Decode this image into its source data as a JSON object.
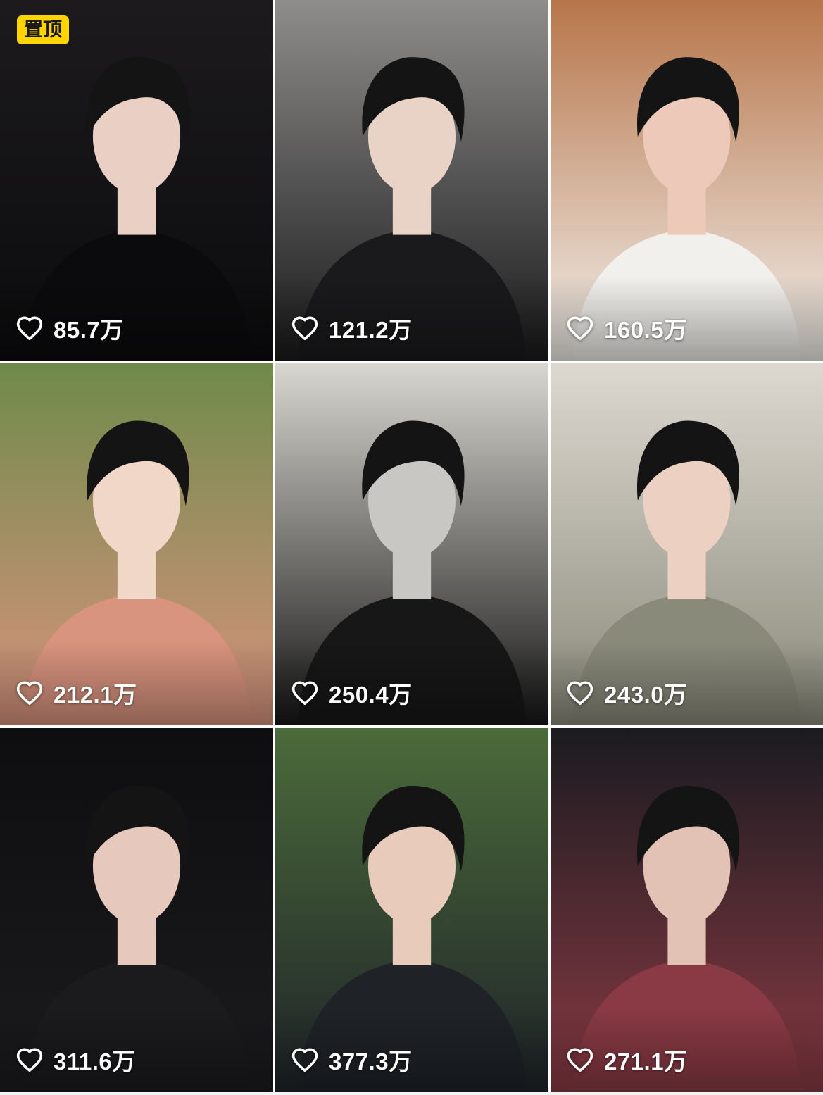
{
  "pinned_label": "置顶",
  "videos": [
    {
      "likes": "85.7万",
      "pinned": true,
      "thumb_colors": [
        "#1c1a1c",
        "#0b0b0d",
        "#e9cfc4"
      ]
    },
    {
      "likes": "121.2万",
      "pinned": false,
      "thumb_colors": [
        "#8f8d8b",
        "#1a1a1c",
        "#e8d3c6"
      ]
    },
    {
      "likes": "160.5万",
      "pinned": false,
      "thumb_colors": [
        "#b7754a",
        "#f2f0ec",
        "#ecc9b9"
      ]
    },
    {
      "likes": "212.1万",
      "pinned": false,
      "thumb_colors": [
        "#6f8a4a",
        "#d9947f",
        "#f0d7c7"
      ]
    },
    {
      "likes": "250.4万",
      "pinned": false,
      "thumb_colors": [
        "#d8d6d0",
        "#171717",
        "#c9c7c3"
      ]
    },
    {
      "likes": "243.0万",
      "pinned": false,
      "thumb_colors": [
        "#ddd8d0",
        "#8a8a7b",
        "#ecd1c2"
      ]
    },
    {
      "likes": "311.6万",
      "pinned": false,
      "thumb_colors": [
        "#0e0e10",
        "#1b1b1e",
        "#e6c8bd"
      ]
    },
    {
      "likes": "377.3万",
      "pinned": false,
      "thumb_colors": [
        "#4b6b3b",
        "#1f2328",
        "#e8cbbb"
      ]
    },
    {
      "likes": "271.1万",
      "pinned": false,
      "thumb_colors": [
        "#1a1b20",
        "#8a3a44",
        "#e3c2b6"
      ]
    }
  ],
  "icons": {
    "like": "heart-outline-icon"
  }
}
